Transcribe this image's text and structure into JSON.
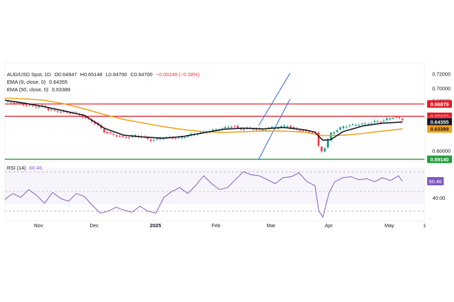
{
  "header": {
    "symbol": "AUD/USD Spot, 1D",
    "open": "O0.64947",
    "high": "H0.65148",
    "low": "L0.64700",
    "close": "C0.64700",
    "change": "−0.00248 (−0.38%)"
  },
  "indicators": {
    "ema9": {
      "label": "EMA (9, close, 0)",
      "value": "0.64355"
    },
    "ema50": {
      "label": "EMA (50, close, 0)",
      "value": "0.63389"
    },
    "rsi": {
      "label": "RSI (14)",
      "value": "60.46"
    }
  },
  "colors": {
    "up": "#089981",
    "down": "#f23645",
    "ema9": "#131722",
    "ema50": "#f0a21b",
    "resistance": "#e0202c",
    "support": "#1e9e3a",
    "channel": "#3a6fe0",
    "rsi": "#7e57c2"
  },
  "chart_data": [
    {
      "type": "candlestick",
      "title": "AUD/USD Spot, 1D",
      "xlabel": "",
      "ylabel": "",
      "x_tick_labels": [
        "Nov",
        "Dec",
        "2025",
        "Feb",
        "Mar",
        "Apr",
        "May",
        "1"
      ],
      "ylim": [
        0.5905,
        0.726
      ],
      "y_ticks": [
        "0.72000",
        "0.70000",
        "0.68000",
        "0.60000"
      ],
      "horizontal_levels": [
        {
          "label": "0.66879",
          "value": 0.66879,
          "color": "#e0202c"
        },
        {
          "label": "0.65156",
          "value": 0.65156,
          "color": "#e0202c"
        },
        {
          "label": "0.59140",
          "value": 0.5914,
          "color": "#1e9e3a"
        }
      ],
      "price_badges": [
        {
          "label": "0.64700",
          "value": 0.647,
          "color": "#f23645"
        },
        {
          "label": "0.64355",
          "value": 0.64355,
          "color": "#131722"
        },
        {
          "label": "0.63389",
          "value": 0.63389,
          "color": "#f0a21b"
        }
      ],
      "ascending_channel": {
        "upper": [
          [
            0.6385,
            0.6385
          ],
          [
            0.7175,
            0.712
          ]
        ],
        "lower": [
          [
            0.6385,
            0.5914
          ],
          [
            0.7175,
            0.676
          ]
        ]
      },
      "close_path": [
        [
          0.0,
          0.672
        ],
        [
          0.02,
          0.671
        ],
        [
          0.04,
          0.669
        ],
        [
          0.06,
          0.6665
        ],
        [
          0.08,
          0.665
        ],
        [
          0.095,
          0.666
        ],
        [
          0.11,
          0.661
        ],
        [
          0.13,
          0.6585
        ],
        [
          0.15,
          0.6575
        ],
        [
          0.17,
          0.656
        ],
        [
          0.19,
          0.653
        ],
        [
          0.21,
          0.647
        ],
        [
          0.23,
          0.641
        ],
        [
          0.25,
          0.63
        ],
        [
          0.27,
          0.626
        ],
        [
          0.29,
          0.623
        ],
        [
          0.31,
          0.622
        ],
        [
          0.33,
          0.6245
        ],
        [
          0.35,
          0.622
        ],
        [
          0.365,
          0.618
        ],
        [
          0.38,
          0.619
        ],
        [
          0.4,
          0.622
        ],
        [
          0.42,
          0.6215
        ],
        [
          0.44,
          0.621
        ],
        [
          0.46,
          0.6245
        ],
        [
          0.48,
          0.6275
        ],
        [
          0.5,
          0.6295
        ],
        [
          0.515,
          0.631
        ],
        [
          0.535,
          0.633
        ],
        [
          0.555,
          0.6355
        ],
        [
          0.575,
          0.6385
        ],
        [
          0.59,
          0.633
        ],
        [
          0.605,
          0.635
        ],
        [
          0.625,
          0.634
        ],
        [
          0.645,
          0.632
        ],
        [
          0.665,
          0.635
        ],
        [
          0.69,
          0.6365
        ],
        [
          0.71,
          0.6385
        ],
        [
          0.73,
          0.633
        ],
        [
          0.75,
          0.631
        ],
        [
          0.77,
          0.629
        ],
        [
          0.785,
          0.628
        ],
        [
          0.79,
          0.605
        ],
        [
          0.795,
          0.604
        ],
        [
          0.8,
          0.601
        ],
        [
          0.805,
          0.608
        ],
        [
          0.812,
          0.617
        ],
        [
          0.82,
          0.628
        ],
        [
          0.835,
          0.632
        ],
        [
          0.85,
          0.637
        ],
        [
          0.87,
          0.639
        ],
        [
          0.89,
          0.6405
        ],
        [
          0.91,
          0.641
        ],
        [
          0.93,
          0.644
        ],
        [
          0.95,
          0.645
        ],
        [
          0.965,
          0.6485
        ],
        [
          0.98,
          0.6505
        ],
        [
          1.0,
          0.647
        ]
      ],
      "ema9_path": [
        [
          0.0,
          0.674
        ],
        [
          0.05,
          0.67
        ],
        [
          0.1,
          0.665
        ],
        [
          0.15,
          0.659
        ],
        [
          0.2,
          0.653
        ],
        [
          0.25,
          0.635
        ],
        [
          0.3,
          0.625
        ],
        [
          0.35,
          0.6225
        ],
        [
          0.4,
          0.621
        ],
        [
          0.45,
          0.6235
        ],
        [
          0.5,
          0.6285
        ],
        [
          0.55,
          0.6335
        ],
        [
          0.6,
          0.635
        ],
        [
          0.65,
          0.634
        ],
        [
          0.7,
          0.636
        ],
        [
          0.75,
          0.633
        ],
        [
          0.78,
          0.6295
        ],
        [
          0.8,
          0.618
        ],
        [
          0.82,
          0.619
        ],
        [
          0.85,
          0.63
        ],
        [
          0.9,
          0.638
        ],
        [
          0.95,
          0.642
        ],
        [
          1.0,
          0.64355
        ]
      ],
      "ema50_path": [
        [
          0.0,
          0.677
        ],
        [
          0.05,
          0.676
        ],
        [
          0.1,
          0.674
        ],
        [
          0.15,
          0.669
        ],
        [
          0.2,
          0.662
        ],
        [
          0.25,
          0.654
        ],
        [
          0.3,
          0.647
        ],
        [
          0.35,
          0.642
        ],
        [
          0.4,
          0.637
        ],
        [
          0.45,
          0.633
        ],
        [
          0.5,
          0.63
        ],
        [
          0.55,
          0.629
        ],
        [
          0.6,
          0.63
        ],
        [
          0.65,
          0.631
        ],
        [
          0.7,
          0.631
        ],
        [
          0.75,
          0.6295
        ],
        [
          0.8,
          0.6245
        ],
        [
          0.85,
          0.625
        ],
        [
          0.9,
          0.6275
        ],
        [
          0.95,
          0.631
        ],
        [
          1.0,
          0.63389
        ]
      ]
    },
    {
      "type": "line",
      "title": "RSI (14)",
      "ylim": [
        20,
        80
      ],
      "y_ticks": [
        "40.00"
      ],
      "guide_levels": [
        70,
        50,
        30
      ],
      "last_value": "60.46",
      "series": [
        {
          "name": "",
          "x": [
            0.0,
            0.02,
            0.04,
            0.06,
            0.08,
            0.1,
            0.12,
            0.14,
            0.16,
            0.18,
            0.2,
            0.22,
            0.24,
            0.26,
            0.28,
            0.3,
            0.32,
            0.34,
            0.36,
            0.38,
            0.4,
            0.42,
            0.44,
            0.46,
            0.48,
            0.5,
            0.52,
            0.54,
            0.56,
            0.58,
            0.6,
            0.62,
            0.64,
            0.66,
            0.68,
            0.7,
            0.72,
            0.74,
            0.76,
            0.78,
            0.79,
            0.8,
            0.815,
            0.83,
            0.85,
            0.87,
            0.89,
            0.91,
            0.93,
            0.95,
            0.97,
            0.99,
            1.0
          ],
          "values": [
            42,
            48,
            44,
            52,
            46,
            38,
            49,
            43,
            40,
            48,
            45,
            36,
            28,
            30,
            34,
            31,
            29,
            35,
            30,
            28,
            44,
            50,
            54,
            48,
            56,
            66,
            58,
            52,
            54,
            62,
            70,
            67,
            66,
            62,
            58,
            64,
            65,
            69,
            60,
            56,
            30,
            24,
            48,
            60,
            64,
            65,
            62,
            63,
            60,
            64,
            61,
            66,
            60.46
          ]
        }
      ]
    }
  ]
}
